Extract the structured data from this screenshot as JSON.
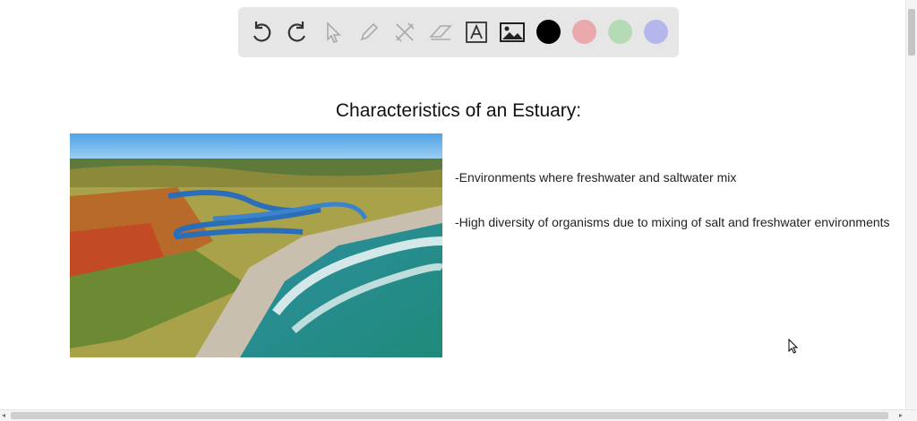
{
  "toolbar": {
    "tools": [
      "undo-icon",
      "redo-icon",
      "pointer-icon",
      "pen-icon",
      "tools-icon",
      "eraser-icon",
      "text-icon",
      "image-icon"
    ],
    "colors": [
      "#000000",
      "#eaa9ad",
      "#b4dbb4",
      "#b4b6ec"
    ]
  },
  "slide": {
    "title": "Characteristics of an Estuary:",
    "bullets": [
      "-Environments where freshwater and saltwater mix",
      "-High diversity of organisms due to mixing of salt and freshwater environments"
    ]
  }
}
